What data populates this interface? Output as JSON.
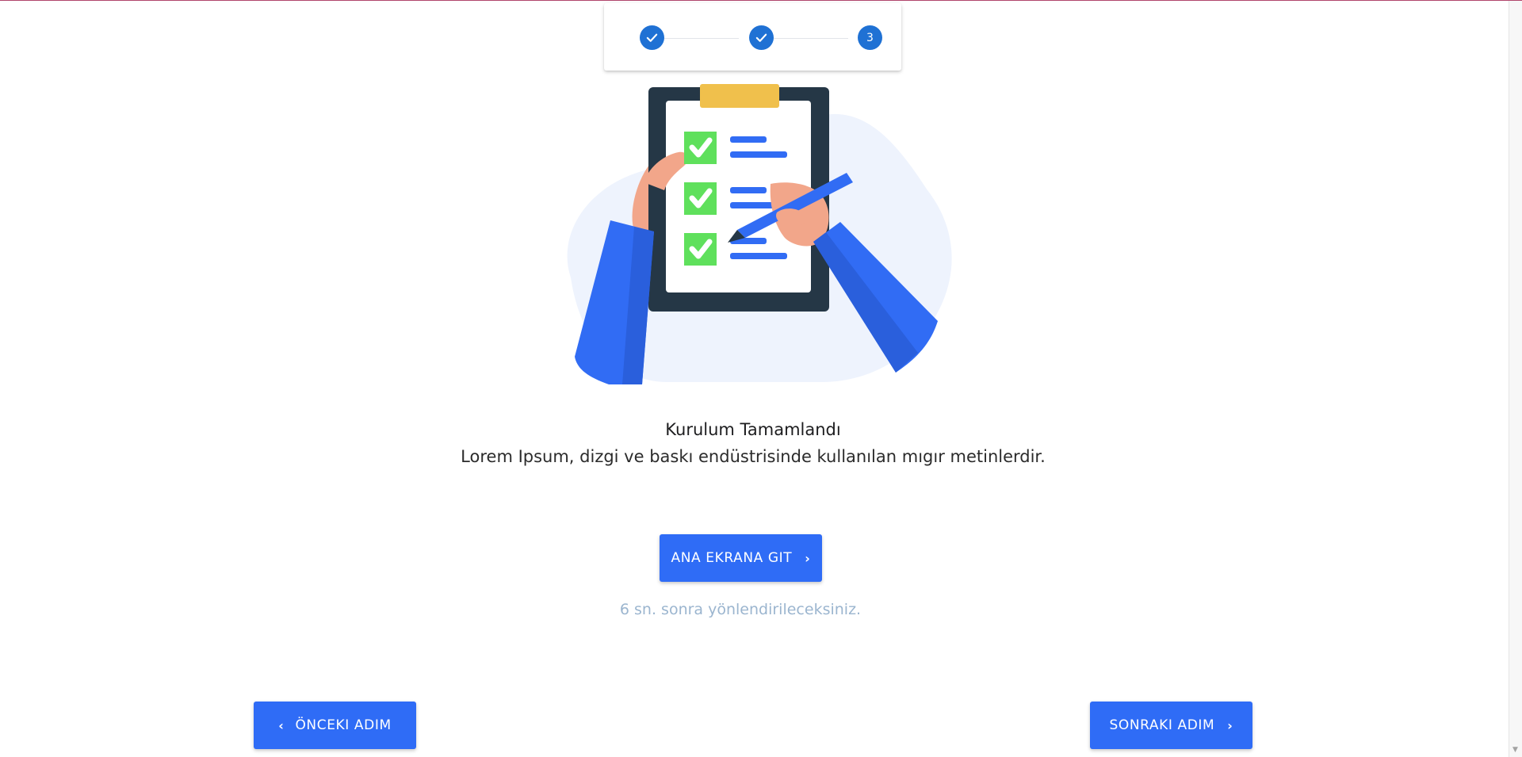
{
  "stepper": {
    "steps": [
      {
        "state": "completed",
        "icon": "check-icon"
      },
      {
        "state": "completed",
        "icon": "check-icon"
      },
      {
        "state": "active",
        "number": "3"
      }
    ],
    "accent_color": "#1f71d4"
  },
  "illustration": {
    "name": "clipboard-checklist-illustration",
    "colors": {
      "blob": "#eef3fd",
      "board": "#253746",
      "clip": "#f0c04c",
      "check": "#5fe05c",
      "line": "#316cf4",
      "skin": "#f2a68a",
      "sleeve": "#316cf4"
    }
  },
  "main": {
    "title": "Kurulum Tamamlandı",
    "subtitle": "Lorem Ipsum, dizgi ve baskı endüstrisinde kullanılan mıgır metinlerdir.",
    "home_button_label": "ANA EKRANA GIT",
    "redirect_text": "6 sn. sonra yönlendirileceksiniz."
  },
  "footer": {
    "prev_button_label": "ÖNCEKI ADIM",
    "next_button_label": "SONRAKI ADIM"
  },
  "theme": {
    "primary": "#2f6cf6",
    "muted_text": "#9bb5cf"
  }
}
